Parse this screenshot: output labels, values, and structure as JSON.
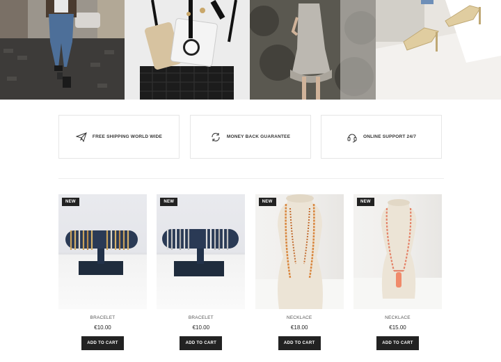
{
  "hero": {
    "tiles": [
      {
        "name": "street-fashion-photo"
      },
      {
        "name": "handbag-accessories-photo"
      },
      {
        "name": "dress-photo"
      },
      {
        "name": "heels-photo"
      }
    ]
  },
  "features": [
    {
      "label": "FREE SHIPPING WORLD WIDE",
      "icon": "paper-plane-icon"
    },
    {
      "label": "MONEY BACK GUARANTEE",
      "icon": "refresh-icon"
    },
    {
      "label": "ONLINE SUPPORT 24/7",
      "icon": "headset-icon"
    }
  ],
  "products": [
    {
      "badge": "NEW",
      "name": "BRACELET",
      "price": "€10.00",
      "cta": "ADD TO CART"
    },
    {
      "badge": "NEW",
      "name": "BRACELET",
      "price": "€10.00",
      "cta": "ADD TO CART"
    },
    {
      "badge": "NEW",
      "name": "NECKLACE",
      "price": "€18.00",
      "cta": "ADD TO CART"
    },
    {
      "badge": "NEW",
      "name": "NECKLACE",
      "price": "€15.00",
      "cta": "ADD TO CART"
    }
  ],
  "colors": {
    "accent": "#222222",
    "border": "#e6e6e6"
  }
}
